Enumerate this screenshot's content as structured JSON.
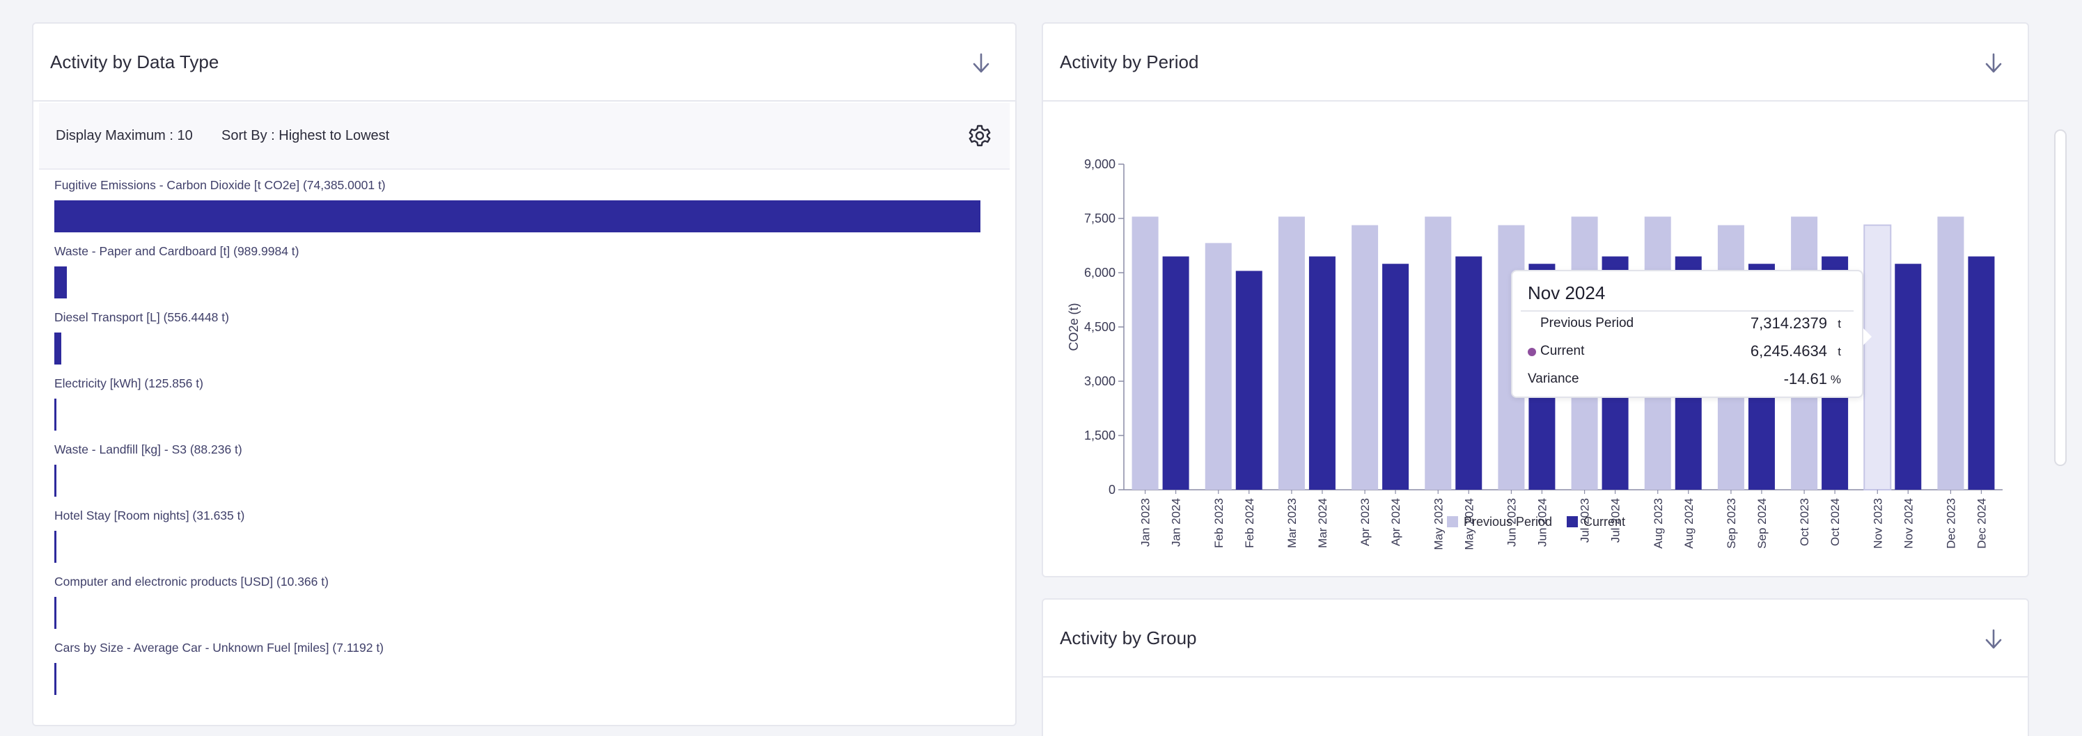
{
  "activity_by_data_type": {
    "title": "Activity by Data Type",
    "display_maximum": "Display Maximum : 10",
    "sort_by": "Sort By : Highest to Lowest",
    "bar_color": "#2e2a9c",
    "items": [
      {
        "label": "Fugitive Emissions - Carbon Dioxide [t CO2e] (74,385.0001 t)",
        "value": 74385.0001
      },
      {
        "label": "Waste - Paper and Cardboard [t] (989.9984 t)",
        "value": 989.9984
      },
      {
        "label": "Diesel Transport [L] (556.4448 t)",
        "value": 556.4448
      },
      {
        "label": "Electricity [kWh] (125.856 t)",
        "value": 125.856
      },
      {
        "label": "Waste - Landfill [kg] - S3 (88.236 t)",
        "value": 88.236
      },
      {
        "label": "Hotel Stay [Room nights] (31.635 t)",
        "value": 31.635
      },
      {
        "label": "Computer and electronic products [USD] (10.366 t)",
        "value": 10.366
      },
      {
        "label": "Cars by Size - Average Car - Unknown Fuel [miles] (7.1192 t)",
        "value": 7.1192
      }
    ]
  },
  "activity_by_period": {
    "title": "Activity by Period"
  },
  "activity_by_group": {
    "title": "Activity by Group"
  },
  "tooltip": {
    "title": "Nov 2024",
    "rows": [
      {
        "label": "Previous Period",
        "value": "7,314.2379",
        "unit": "t"
      },
      {
        "label": "Current",
        "value": "6,245.4634",
        "unit": "t"
      },
      {
        "label": "Variance",
        "value": "-14.61",
        "unit": "%"
      }
    ],
    "current_dot_color": "#8e4f9e"
  },
  "chart_data": {
    "type": "bar",
    "ylabel": "CO2e (t)",
    "ylim": [
      0,
      9000
    ],
    "yticks": [
      "0",
      "1,500",
      "3,000",
      "4,500",
      "6,000",
      "7,500",
      "9,000"
    ],
    "ytick_values": [
      0,
      1500,
      3000,
      4500,
      6000,
      7500,
      9000
    ],
    "categories": [
      "Jan",
      "Feb",
      "Mar",
      "Apr",
      "May",
      "Jun",
      "Jul",
      "Aug",
      "Sep",
      "Oct",
      "Nov",
      "Dec"
    ],
    "series": [
      {
        "name": "Previous Period",
        "color": "#c5c5e6",
        "x_labels": [
          "Jan 2023",
          "Feb 2023",
          "Mar 2023",
          "Apr 2023",
          "May 2023",
          "Jun 2023",
          "Jul 2023",
          "Aug 2023",
          "Sep 2023",
          "Oct 2023",
          "Nov 2023",
          "Dec 2023"
        ],
        "values": [
          7550,
          6820,
          7550,
          7314.2,
          7550,
          7314.2,
          7550,
          7550,
          7314.2,
          7550,
          7314.2379,
          7550
        ]
      },
      {
        "name": "Current",
        "color": "#2e2a9c",
        "x_labels": [
          "Jan 2024",
          "Feb 2024",
          "Mar 2024",
          "Apr 2024",
          "May 2024",
          "Jun 2024",
          "Jul 2024",
          "Aug 2024",
          "Sep 2024",
          "Oct 2024",
          "Nov 2024",
          "Dec 2024"
        ],
        "values": [
          6450,
          6050,
          6450,
          6245.5,
          6450,
          6245.5,
          6450,
          6450,
          6245.5,
          6450,
          6245.4634,
          6450
        ]
      }
    ],
    "highlighted_category": "Nov",
    "highlight_color": "#e6e6f6",
    "legend_position": "bottom",
    "grid": false
  }
}
